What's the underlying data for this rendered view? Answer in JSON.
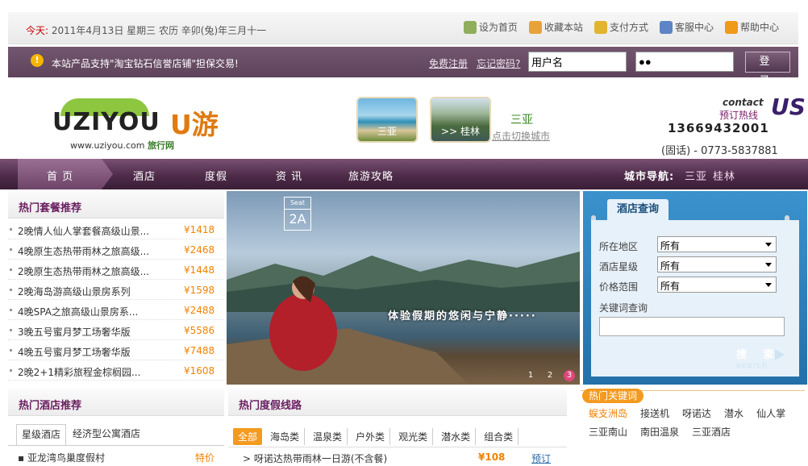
{
  "topbar": {
    "today_label": "今天:",
    "date_text": "2011年4月13日 星期三 农历 辛卯(兔)年三月十一",
    "links": [
      {
        "label": "设为首页",
        "icon": "home-icon",
        "color": "#8fae5c"
      },
      {
        "label": "收藏本站",
        "icon": "favorite-icon",
        "color": "#e8a23a"
      },
      {
        "label": "支付方式",
        "icon": "coins-icon",
        "color": "#e2b530"
      },
      {
        "label": "客服中心",
        "icon": "people-icon",
        "color": "#5d84c4"
      },
      {
        "label": "帮助中心",
        "icon": "help-icon",
        "color": "#f09a1a"
      }
    ]
  },
  "loginbar": {
    "notice": "本站产品支持\"淘宝钻石信誉店铺\"担保交易!",
    "register": "免费注册",
    "forgot": "忘记密码?",
    "username_value": "用户名",
    "password_value": "●●",
    "login_label": "登 录"
  },
  "header": {
    "logo_text": "UZIYOU",
    "logo_cn": "U游",
    "logo_url": "www.uziyou.com",
    "logo_sub": "旅行网",
    "cities": [
      {
        "label": "三亚"
      },
      {
        "label": ">> 桂林"
      }
    ],
    "current_city": "三亚",
    "switch_label": "点击切换城市",
    "contact_en": "contact",
    "contact_cn": "预订热线",
    "contact_us": "US",
    "phone": "13669432001",
    "tel": "(固话) - 0773-5837881"
  },
  "nav": {
    "items": [
      "首 页",
      "酒店",
      "度假",
      "资 讯",
      "旅游攻略"
    ],
    "city_nav_label": "城市导航:",
    "city_nav": [
      "三亚",
      "桂林"
    ]
  },
  "packages": {
    "title": "热门套餐推荐",
    "items": [
      {
        "name": "2晚情人仙人掌套餐高级山景...",
        "price": "¥1418"
      },
      {
        "name": "4晚原生态热带雨林之旅高级...",
        "price": "¥2468"
      },
      {
        "name": "2晚原生态热带雨林之旅高级...",
        "price": "¥1448"
      },
      {
        "name": "2晚海岛游高级山景房系列",
        "price": "¥1598"
      },
      {
        "name": "4晚SPA之旅高级山景房系...",
        "price": "¥2488"
      },
      {
        "name": "3晚五号蜜月梦工场奢华版",
        "price": "¥5586"
      },
      {
        "name": "4晚五号蜜月梦工场奢华版",
        "price": "¥7488"
      },
      {
        "name": "2晚2+1精彩旅程金棕榈园...",
        "price": "¥1608"
      }
    ]
  },
  "banner": {
    "seat_label": "Seat",
    "seat_no": "2A",
    "caption": "体验假期的悠闲与宁静·····",
    "pages": [
      "1",
      "2",
      "3"
    ]
  },
  "hotel_query": {
    "title": "酒店查询",
    "fields": [
      {
        "label": "所在地区",
        "value": "所有"
      },
      {
        "label": "酒店星级",
        "value": "所有"
      },
      {
        "label": "价格范围",
        "value": "所有"
      }
    ],
    "keyword_label": "关键词查询",
    "search_label": "搜 索",
    "search_en": "search"
  },
  "hot_hotels": {
    "title": "热门酒店推荐",
    "tabs": [
      "星级酒店",
      "经济型公寓酒店"
    ],
    "rows": [
      {
        "name": "亚龙湾鸟巢度假村",
        "price": "特价"
      }
    ]
  },
  "hot_routes": {
    "title": "热门度假线路",
    "tabs": [
      "全部",
      "海岛类",
      "温泉类",
      "户外类",
      "观光类",
      "潜水类",
      "组合类"
    ],
    "rows": [
      {
        "name": "呀诺达热带雨林一日游(不含餐)",
        "price": "¥108",
        "action": "预订"
      }
    ]
  },
  "hot_keywords": {
    "title": "热门关键词",
    "words": [
      "蜈支洲岛",
      "接送机",
      "呀诺达",
      "潜水",
      "仙人掌",
      "三亚南山",
      "南田温泉",
      "三亚酒店"
    ]
  }
}
